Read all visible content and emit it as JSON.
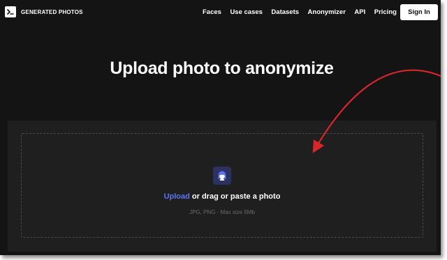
{
  "brand": {
    "name": "GENERATED PHOTOS",
    "logo_icon": "terminal-prompt-icon"
  },
  "nav": {
    "items": [
      {
        "label": "Faces"
      },
      {
        "label": "Use cases"
      },
      {
        "label": "Datasets"
      },
      {
        "label": "Anonymizer"
      },
      {
        "label": "API"
      },
      {
        "label": "Pricing"
      }
    ],
    "signin_label": "Sign In"
  },
  "hero": {
    "title": "Upload photo to anonymize"
  },
  "upload": {
    "icon": "face-avatar-icon",
    "link_label": "Upload",
    "instruction_rest": " or drag or paste a photo",
    "formats_hint": "JPG, PNG · Max size 5Mb"
  },
  "colors": {
    "background": "#141414",
    "panel": "#1f1f1f",
    "accent": "#5b73f0",
    "annotation_arrow": "#d9262b"
  }
}
